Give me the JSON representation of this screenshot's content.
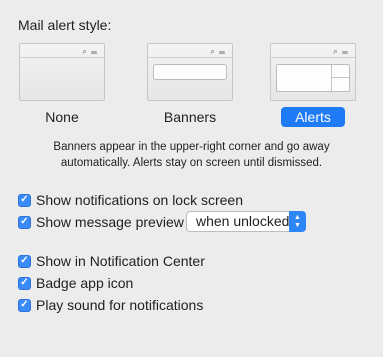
{
  "heading": "Mail alert style:",
  "styles": [
    {
      "label": "None"
    },
    {
      "label": "Banners"
    },
    {
      "label": "Alerts"
    }
  ],
  "description": "Banners appear in the upper-right corner and go away automatically. Alerts stay on screen until dismissed.",
  "options": {
    "lock_screen": {
      "label": "Show notifications on lock screen",
      "checked": true
    },
    "message_preview": {
      "label": "Show message preview",
      "checked": true,
      "select_value": "when unlocked"
    },
    "notification_center": {
      "label": "Show in Notification Center",
      "checked": true
    },
    "badge": {
      "label": "Badge app icon",
      "checked": true
    },
    "sound": {
      "label": "Play sound for notifications",
      "checked": true
    }
  },
  "colors": {
    "accent": "#1f7af5",
    "checkbox": "#3a8bf7"
  },
  "thumbnail_toolbar_icons": "⌕ ☰"
}
